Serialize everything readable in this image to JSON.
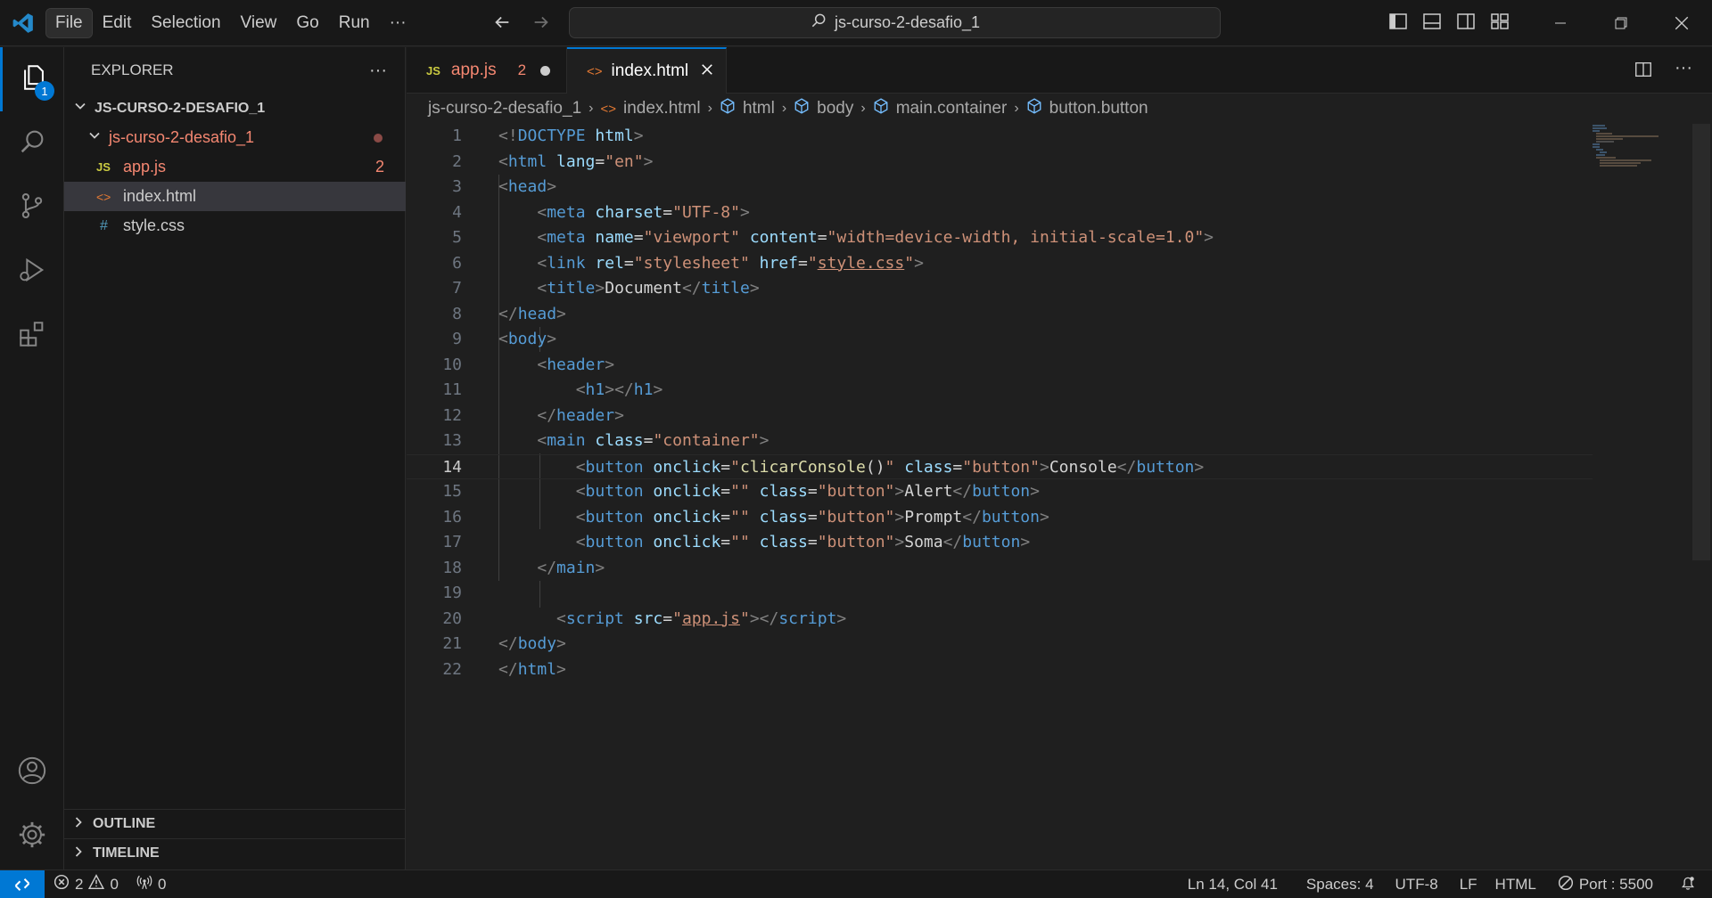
{
  "titlebar": {
    "menu": [
      "File",
      "Edit",
      "Selection",
      "View",
      "Go",
      "Run"
    ],
    "more": "···",
    "search": "js-curso-2-desafio_1"
  },
  "activity": {
    "explorer_badge": "1"
  },
  "sidebar": {
    "title": "EXPLORER",
    "more": "···",
    "workspace": "JS-CURSO-2-DESAFIO_1",
    "folder": "js-curso-2-desafio_1",
    "files": [
      {
        "icon": "JS",
        "name": "app.js",
        "badge": "2",
        "color": "#f48771"
      },
      {
        "icon": "<>",
        "name": "index.html",
        "badge": "",
        "color": "#cccccc"
      },
      {
        "icon": "#",
        "name": "style.css",
        "badge": "",
        "color": "#cccccc"
      }
    ],
    "outline": "OUTLINE",
    "timeline": "TIMELINE"
  },
  "tabs": [
    {
      "icon": "JS",
      "label": "app.js",
      "badge": "2"
    },
    {
      "icon": "<>",
      "label": "index.html"
    }
  ],
  "breadcrumbs": [
    "js-curso-2-desafio_1",
    "index.html",
    "html",
    "body",
    "main.container",
    "button.button"
  ],
  "code": {
    "current_line": 14,
    "lines": [
      "1",
      "2",
      "3",
      "4",
      "5",
      "6",
      "7",
      "8",
      "9",
      "10",
      "11",
      "12",
      "13",
      "14",
      "15",
      "16",
      "17",
      "18",
      "19",
      "20",
      "21",
      "22"
    ]
  },
  "status": {
    "errors": "2",
    "warnings": "0",
    "ports": "0",
    "position": "Ln 14, Col 41",
    "spaces": "Spaces: 4",
    "encoding": "UTF-8",
    "eol": "LF",
    "language": "HTML",
    "port": "Port : 5500"
  },
  "colors": {
    "accent": "#0078d4",
    "error": "#f48771",
    "background": "#1f1f1f"
  }
}
